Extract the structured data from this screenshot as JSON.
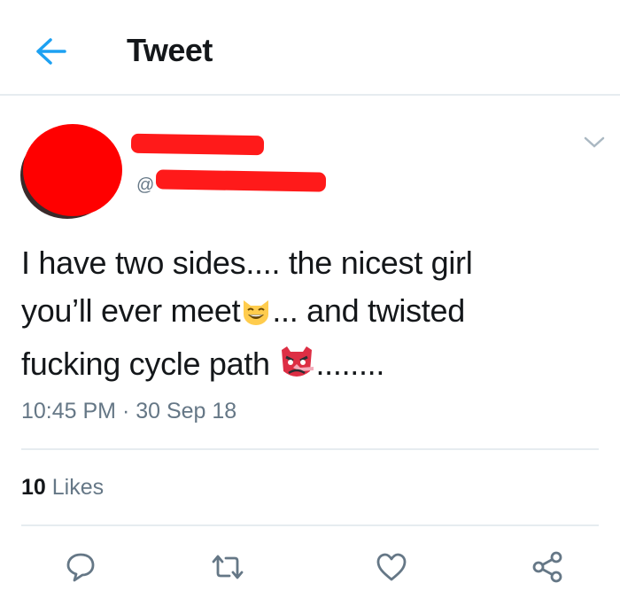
{
  "header": {
    "title": "Tweet",
    "back_icon": "arrow-left-icon",
    "accent_color": "#1da1f2"
  },
  "author": {
    "handle_prefix": "@"
  },
  "tweet": {
    "line1": "I have two sides.... the nicest girl",
    "line2a": "you’ll ever meet",
    "line2b": "... and twisted",
    "line3a": "fucking cycle path ",
    "line3b": "........",
    "emoji1": "grinning-cat-with-smiling-eyes-emoji",
    "emoji2": "red-goblin-mask-emoji",
    "timestamp": "10:45 PM · 30 Sep 18"
  },
  "stats": {
    "likes_count": "10",
    "likes_label": " Likes"
  },
  "actions": {
    "reply": "reply-icon",
    "retweet": "retweet-icon",
    "like": "heart-icon",
    "share": "share-icon"
  },
  "colors": {
    "text": "#14171a",
    "muted": "#657786",
    "divider": "#e6ecf0",
    "redaction": "#ff0000"
  }
}
